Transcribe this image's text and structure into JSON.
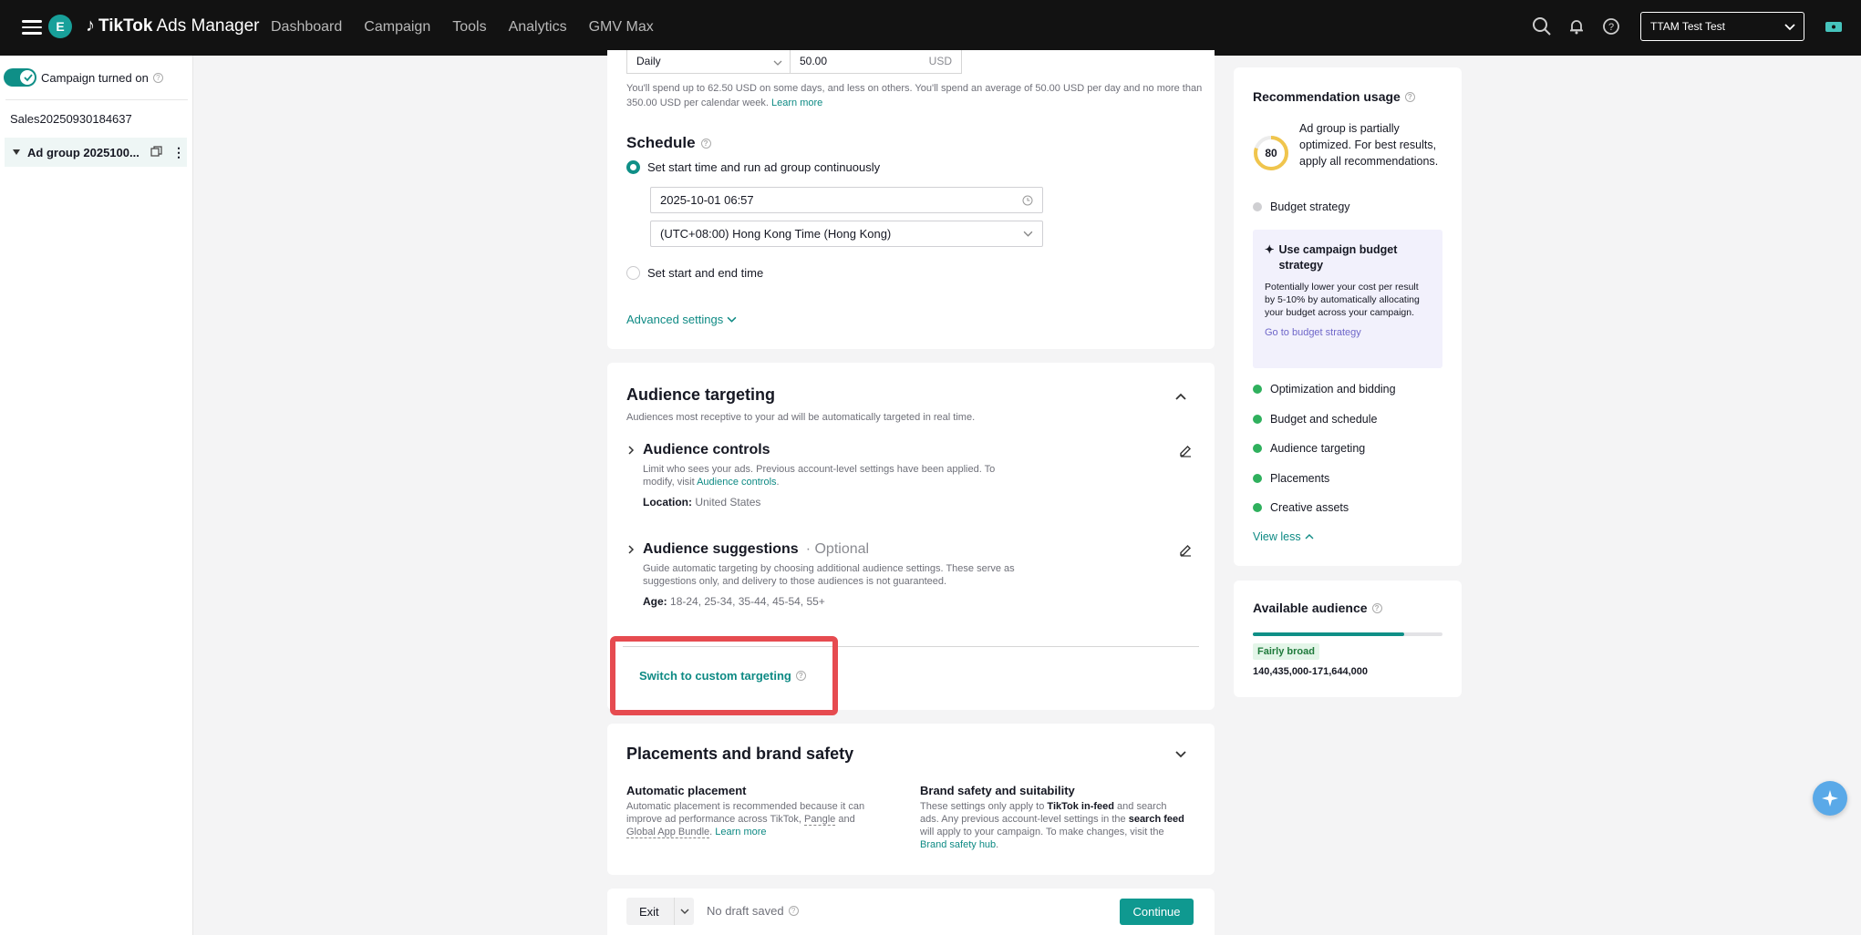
{
  "topbar": {
    "avatar_letter": "E",
    "brand_main": "TikTok",
    "brand_sub": "Ads Manager",
    "nav": [
      "Dashboard",
      "Campaign",
      "Tools",
      "Analytics",
      "GMV Max"
    ],
    "account": "TTAM Test Test",
    "icons": [
      "menu-icon",
      "search-icon",
      "bell-icon",
      "help-icon",
      "chevron-down-icon",
      "ticket-icon"
    ]
  },
  "sidebar": {
    "campaign_toggle_label": "Campaign turned on",
    "campaign_name": "Sales20250930184637",
    "ad_group_name": "Ad group 2025100..."
  },
  "budget": {
    "mode": "Daily",
    "amount": "50.00",
    "currency": "USD",
    "note_text": "You'll spend up to 62.50 USD on some days, and less on others. You'll spend an average of 50.00 USD per day and no more than 350.00 USD per calendar week.",
    "learn_more": "Learn more"
  },
  "schedule": {
    "title": "Schedule",
    "option_continuous": "Set start time and run ad group continuously",
    "start_time": "2025-10-01 06:57",
    "timezone": "(UTC+08:00) Hong Kong Time (Hong Kong)",
    "option_start_end": "Set start and end time",
    "advanced_settings": "Advanced settings"
  },
  "audience": {
    "title": "Audience targeting",
    "subtitle": "Audiences most receptive to your ad will be automatically targeted in real time.",
    "controls_title": "Audience controls",
    "controls_desc": "Limit who sees your ads. Previous account-level settings have been applied. To modify, visit",
    "controls_link": "Audience controls",
    "location_label": "Location:",
    "location_value": "United States",
    "suggestions_title": "Audience suggestions",
    "suggestions_optional": "· Optional",
    "suggestions_desc": "Guide automatic targeting by choosing additional audience settings. These serve as suggestions only, and delivery to those audiences is not guaranteed.",
    "age_label": "Age:",
    "age_value": "18-24, 25-34, 35-44, 45-54, 55+",
    "switch_link": "Switch to custom targeting"
  },
  "placements": {
    "title": "Placements and brand safety",
    "auto_title": "Automatic placement",
    "auto_desc_1": "Automatic placement is recommended because it can improve ad performance across TikTok,",
    "auto_pangle": "Pangle",
    "auto_and": "and",
    "auto_global": "Global App Bundle",
    "auto_learn": "Learn more",
    "brand_title": "Brand safety and suitability",
    "brand_desc_1": "These settings only apply to",
    "brand_bold_1": "TikTok in-feed",
    "brand_desc_2": "and search ads. Any previous account-level settings in the",
    "brand_bold_2": "search feed",
    "brand_desc_3": "will apply to your campaign. To make changes, visit the",
    "brand_link": "Brand safety hub"
  },
  "footer": {
    "exit": "Exit",
    "draft_status": "No draft saved",
    "continue": "Continue"
  },
  "recommendation": {
    "title": "Recommendation usage",
    "score": "80",
    "score_fraction": 0.8,
    "desc": "Ad group is partially optimized. For best results, apply all recommendations.",
    "budget_strategy": "Budget strategy",
    "tip_title": "Use campaign budget strategy",
    "tip_desc": "Potentially lower your cost per result by 5-10% by automatically allocating your budget across your campaign.",
    "tip_link": "Go to budget strategy",
    "items": [
      "Optimization and bidding",
      "Budget and schedule",
      "Audience targeting",
      "Placements",
      "Creative assets"
    ],
    "view_less": "View less"
  },
  "available_audience": {
    "title": "Available audience",
    "level_fraction": 0.8,
    "badge": "Fairly broad",
    "range": "140,435,000-171,644,000"
  },
  "colors": {
    "accent": "#0f8f87",
    "highlight": "#e64b50",
    "score_ring": "#f0c54d"
  }
}
